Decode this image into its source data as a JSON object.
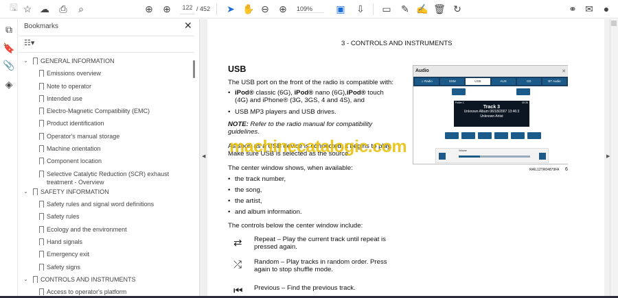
{
  "toolbar": {
    "page_current": "122",
    "page_total": "/ 452",
    "zoom": "109%"
  },
  "bookmarks": {
    "title": "Bookmarks",
    "items": [
      {
        "label": "GENERAL INFORMATION",
        "level": 0
      },
      {
        "label": "Emissions overview",
        "level": 1
      },
      {
        "label": "Note to operator",
        "level": 1
      },
      {
        "label": "Intended use",
        "level": 1
      },
      {
        "label": "Electro-Magnetic Compatibility (EMC)",
        "level": 1
      },
      {
        "label": "Product identification",
        "level": 1
      },
      {
        "label": "Operator's manual storage",
        "level": 1
      },
      {
        "label": "Machine orientation",
        "level": 1
      },
      {
        "label": "Component location",
        "level": 1
      },
      {
        "label": "Selective Catalytic Reduction (SCR) exhaust treatment - Overview",
        "level": 1
      },
      {
        "label": "SAFETY INFORMATION",
        "level": 0
      },
      {
        "label": "Safety rules and signal word definitions",
        "level": 1
      },
      {
        "label": "Safety rules",
        "level": 1
      },
      {
        "label": "Ecology and the environment",
        "level": 1
      },
      {
        "label": "Hand signals",
        "level": 1
      },
      {
        "label": "Emergency exit",
        "level": 1
      },
      {
        "label": "Safety signs",
        "level": 1
      },
      {
        "label": "CONTROLS AND INSTRUMENTS",
        "level": 0
      },
      {
        "label": "Access to operator's platform",
        "level": 1
      }
    ]
  },
  "page": {
    "header": "3 - CONTROLS AND INSTRUMENTS",
    "heading": "USB",
    "intro": "The USB port on the front of the radio is compatible with:",
    "bullets1": [
      "iPod® classic (6G), iPod® nano (6G),iPod® touch (4G) and iPhone® (3G, 3GS, 4 and 4S), and",
      "USB MP3 players and USB drives."
    ],
    "note_label": "NOTE:",
    "note": "Refer to the radio manual for compatibility guidelines.",
    "connect": "As soon as a USB device is connected, it begins to play. Make sure USB is selected as the source.",
    "center_intro": "The center window shows, when available:",
    "bullets2": [
      "the track number,",
      "the song,",
      "the artist,",
      "and album information."
    ],
    "controls_intro": "The controls below the center window include:",
    "controls": [
      {
        "icon": "repeat-icon",
        "glyph": "⇄",
        "text": "Repeat – Play the current track until repeat is pressed again."
      },
      {
        "icon": "shuffle-icon",
        "glyph": "⤮",
        "text": "Random – Play tracks in random order. Press again to stop shuffle mode."
      },
      {
        "icon": "previous-icon",
        "glyph": "⏮",
        "text": "Previous – Find the previous track."
      }
    ],
    "watermark": "machinecatalogic.com",
    "figure": {
      "title": "Audio",
      "tabs": [
        "♫ Radio",
        "SXM",
        "USB",
        "AUX",
        "CD",
        "BT Audio"
      ],
      "folder": "Folder 1",
      "time": "00:26",
      "track": "Track 3",
      "album": "Unknown Album 06/18/2007 13:46:3",
      "artist": "Unknown Artist",
      "volume_label": "Volume",
      "volume_level": 0.3,
      "caption": "RAIL12TR04879FA",
      "fig_no": "6"
    }
  }
}
